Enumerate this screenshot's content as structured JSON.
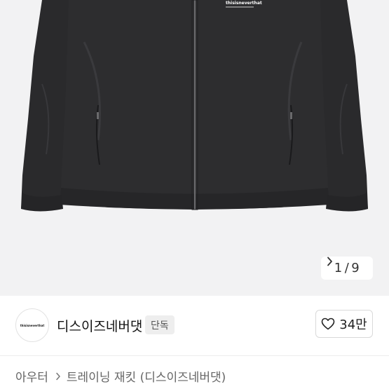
{
  "gallery": {
    "current": "1",
    "separator": "/",
    "total": "9",
    "image_logo_text": "thisisneverthat",
    "colors": {
      "background": "#f2f2f3",
      "jacket": "#2b2b2d"
    }
  },
  "brand": {
    "logo_text": "thisisneverthat",
    "name": "디스이즈네버댓",
    "badge": "단독"
  },
  "like": {
    "count": "34만",
    "icon": "heart-outline-icon"
  },
  "breadcrumb": {
    "category": "아우터",
    "product": "트레이닝 재킷 (디스이즈네버댓)",
    "separator_icon": "chevron-right-icon"
  }
}
